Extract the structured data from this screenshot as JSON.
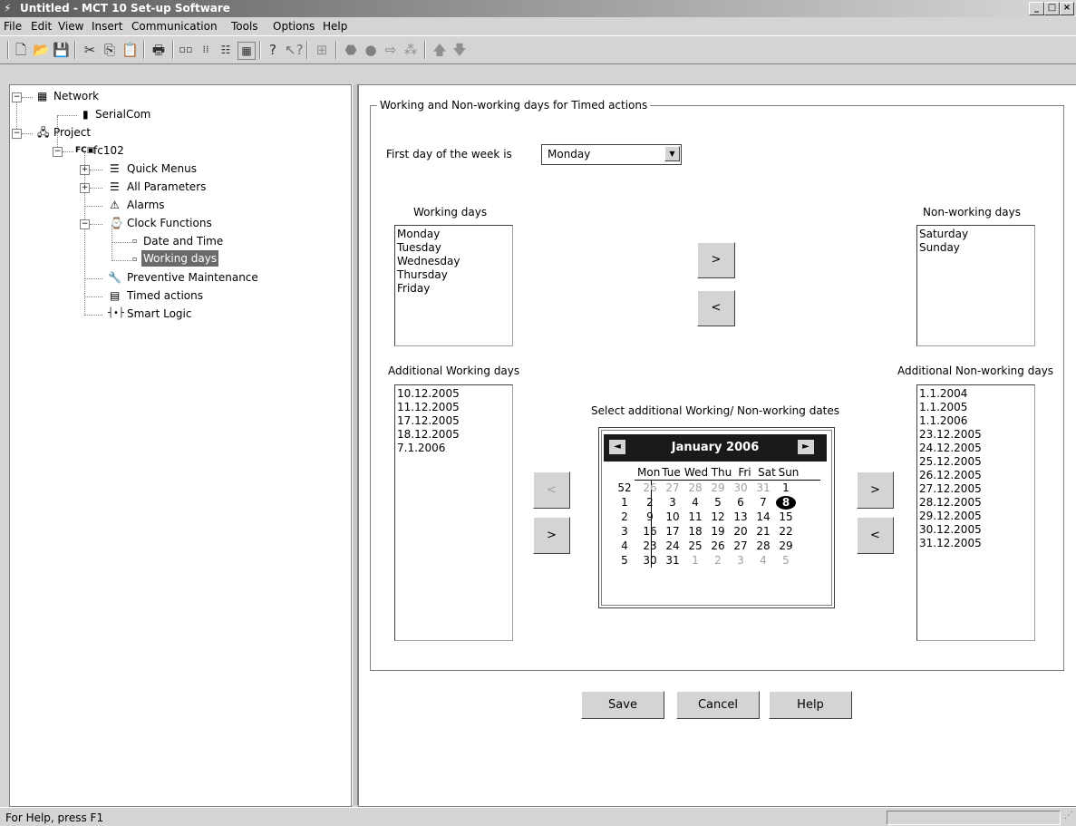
{
  "window": {
    "title": "Untitled - MCT 10 Set-up Software",
    "min": "_",
    "max": "□",
    "close": "×"
  },
  "menu": [
    "File",
    "Edit",
    "View",
    "Insert",
    "Communication",
    "Tools",
    "Options",
    "Help"
  ],
  "toolbar": [
    "new-icon",
    "open-icon",
    "save-icon",
    "cut-icon",
    "copy-icon",
    "paste-icon",
    "print-icon",
    "large-icons-icon",
    "small-icons-icon",
    "list-icon",
    "details-icon",
    "help-icon",
    "context-help-icon",
    "drive-icon",
    "stop-icon",
    "record-icon",
    "play-icon",
    "connect-icon",
    "up-icon",
    "down-icon"
  ],
  "tree": {
    "network": "Network",
    "serialcom": "SerialCom",
    "project": "Project",
    "fc102": "fc102",
    "quick_menus": "Quick Menus",
    "all_parameters": "All Parameters",
    "alarms": "Alarms",
    "clock_functions": "Clock Functions",
    "date_time": "Date and Time",
    "working_days": "Working days",
    "preventive_maintenance": "Preventive Maintenance",
    "timed_actions": "Timed actions",
    "smart_logic": "Smart Logic"
  },
  "panel": {
    "group_title": "Working and Non-working days for Timed actions",
    "first_day_label": "First day of the week is",
    "first_day_value": "Monday",
    "working_days_label": "Working days",
    "non_working_days_label": "Non-working days",
    "working_days": [
      "Monday",
      "Tuesday",
      "Wednesday",
      "Thursday",
      "Friday"
    ],
    "non_working_days": [
      "Saturday",
      "Sunday"
    ],
    "move_right": ">",
    "move_left": "<",
    "additional_working_label": "Additional Working days",
    "additional_non_working_label": "Additional Non-working days",
    "additional_working": [
      "10.12.2005",
      "11.12.2005",
      "17.12.2005",
      "18.12.2005",
      "7.1.2006"
    ],
    "additional_non_working": [
      "1.1.2004",
      "1.1.2005",
      "1.1.2006",
      "23.12.2005",
      "24.12.2005",
      "25.12.2005",
      "26.12.2005",
      "27.12.2005",
      "28.12.2005",
      "29.12.2005",
      "30.12.2005",
      "31.12.2005"
    ],
    "select_dates_label": "Select additional Working/ Non-working dates"
  },
  "calendar": {
    "month_title": "January 2006",
    "prev": "◄",
    "next": "►",
    "weekdays": [
      "Mon",
      "Tue",
      "Wed",
      "Thu",
      "Fri",
      "Sat",
      "Sun"
    ],
    "weeks": [
      {
        "num": "52",
        "days": [
          "26",
          "27",
          "28",
          "29",
          "30",
          "31",
          "1"
        ],
        "grey": [
          true,
          true,
          true,
          true,
          true,
          true,
          false
        ]
      },
      {
        "num": "1",
        "days": [
          "2",
          "3",
          "4",
          "5",
          "6",
          "7",
          "8"
        ],
        "grey": [
          false,
          false,
          false,
          false,
          false,
          false,
          false
        ]
      },
      {
        "num": "2",
        "days": [
          "9",
          "10",
          "11",
          "12",
          "13",
          "14",
          "15"
        ],
        "grey": [
          false,
          false,
          false,
          false,
          false,
          false,
          false
        ]
      },
      {
        "num": "3",
        "days": [
          "16",
          "17",
          "18",
          "19",
          "20",
          "21",
          "22"
        ],
        "grey": [
          false,
          false,
          false,
          false,
          false,
          false,
          false
        ]
      },
      {
        "num": "4",
        "days": [
          "23",
          "24",
          "25",
          "26",
          "27",
          "28",
          "29"
        ],
        "grey": [
          false,
          false,
          false,
          false,
          false,
          false,
          false
        ]
      },
      {
        "num": "5",
        "days": [
          "30",
          "31",
          "1",
          "2",
          "3",
          "4",
          "5"
        ],
        "grey": [
          false,
          false,
          true,
          true,
          true,
          true,
          true
        ]
      }
    ],
    "today": "8"
  },
  "buttons": {
    "save": "Save",
    "cancel": "Cancel",
    "help": "Help"
  },
  "status": {
    "text": "For Help, press F1"
  }
}
